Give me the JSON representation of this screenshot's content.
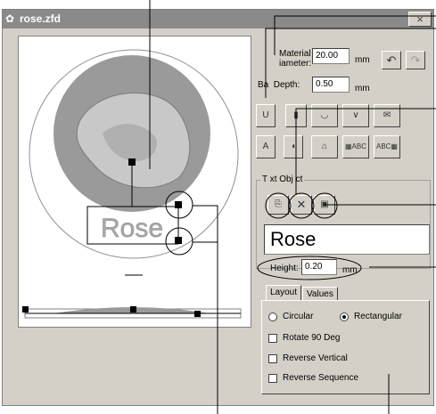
{
  "window": {
    "title": "rose.zfd",
    "close_label": "×"
  },
  "canvas": {
    "preview_text": "Rose"
  },
  "panel": {
    "material_diameter_label_line1": "Material",
    "material_diameter_label_line2": "iameter:",
    "material_diameter_value": "20.00",
    "material_diameter_unit": "mm",
    "base_depth_label": "Ba  Depth:",
    "base_depth_value": "0.50",
    "base_depth_unit": "mm",
    "text_object_label": "T xt Obj ct",
    "text_value": "Rose",
    "height_label": "Height:",
    "height_value": "0.20",
    "height_unit": "mm",
    "tabs": [
      {
        "label": "Layout"
      },
      {
        "label": "Values"
      }
    ],
    "layout": {
      "circular_label": "Circular",
      "rectangular_label": "Rectangular",
      "rotate_label": "Rotate 90 Deg",
      "reverse_vertical_label": "Reverse Vertical",
      "reverse_sequence_label": "Reverse Sequence",
      "selected_layout": "Rectangular"
    }
  }
}
